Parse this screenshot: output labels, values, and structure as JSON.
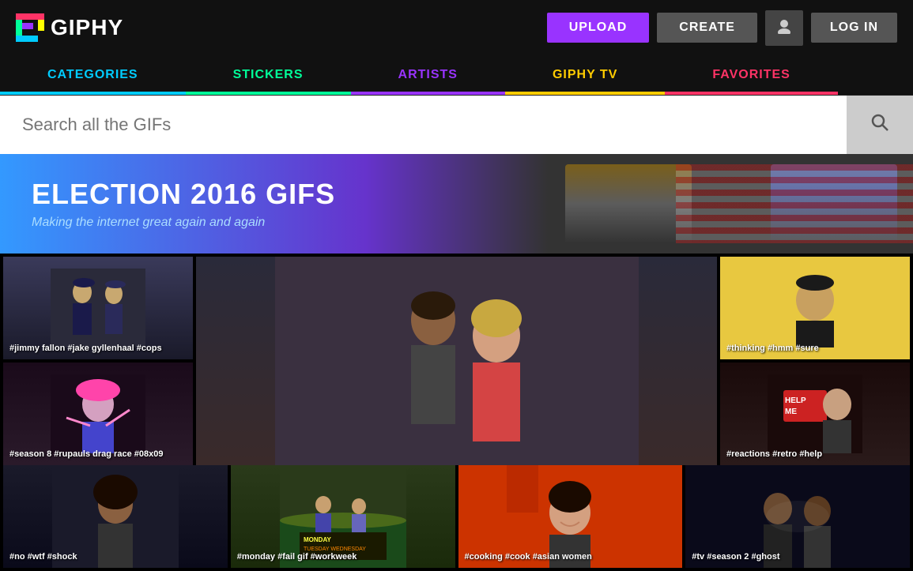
{
  "header": {
    "logo_text": "GIPHY",
    "upload_label": "UPLOAD",
    "create_label": "CREATE",
    "login_label": "LOG IN"
  },
  "nav": {
    "items": [
      {
        "id": "categories",
        "label": "CATEGORIES",
        "color": "#00ccff"
      },
      {
        "id": "stickers",
        "label": "STICKERS",
        "color": "#00ff99"
      },
      {
        "id": "artists",
        "label": "ARTISTS",
        "color": "#9933ff"
      },
      {
        "id": "giphytv",
        "label": "GIPHY TV",
        "color": "#ffcc00"
      },
      {
        "id": "favorites",
        "label": "FAVORITES",
        "color": "#ff3366"
      }
    ]
  },
  "search": {
    "placeholder": "Search all the GIFs"
  },
  "banner": {
    "title": "ELECTION 2016 GIFS",
    "subtitle": "Making the internet great again and again"
  },
  "gifs": {
    "row1": [
      {
        "id": "gif-cops",
        "tags": "#jimmy fallon #jake gyllenhaal #cops"
      },
      {
        "id": "gif-couple",
        "tags": ""
      },
      {
        "id": "gif-thinking",
        "tags": "#thinking #hmm #sure"
      }
    ],
    "row2": [
      {
        "id": "gif-dragrace",
        "tags": "#season 8 #rupauls drag race #08x09"
      },
      {
        "id": "gif-help",
        "tags": "#reactions #retro #help"
      }
    ],
    "row3": [
      {
        "id": "gif-no",
        "tags": "#no #wtf #shock"
      },
      {
        "id": "gif-monday",
        "tags": "#monday #fail gif #workweek"
      },
      {
        "id": "gif-cooking",
        "tags": "#cooking #cook #asian women"
      },
      {
        "id": "gif-tv",
        "tags": "#tv #season 2 #ghost"
      }
    ]
  }
}
